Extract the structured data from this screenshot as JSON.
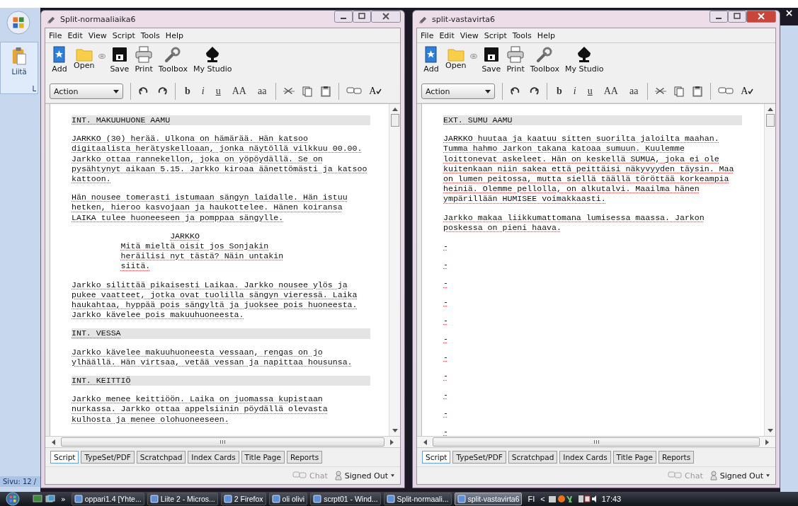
{
  "word": {
    "paste_label": "Liitä",
    "group_label": "L",
    "status": "Sivu: 12 /"
  },
  "windows": [
    {
      "title": "Split-normaaliaika6",
      "active": false,
      "menu": [
        "File",
        "Edit",
        "View",
        "Script",
        "Tools",
        "Help"
      ],
      "toolbar": [
        {
          "label": "Add",
          "kind": "add"
        },
        {
          "label": "Open",
          "kind": "open"
        },
        {
          "label": "Save",
          "kind": "save"
        },
        {
          "label": "Print",
          "kind": "print"
        },
        {
          "label": "Toolbox",
          "kind": "toolbox"
        },
        {
          "label": "My Studio",
          "kind": "studio"
        }
      ],
      "element_style": "Action",
      "format_buttons": [
        {
          "label": "b",
          "kind": "bold"
        },
        {
          "label": "i",
          "kind": "italic"
        },
        {
          "label": "u",
          "kind": "underline"
        },
        {
          "label": "AA",
          "kind": "upper"
        },
        {
          "label": "aa",
          "kind": "lower"
        }
      ],
      "spell_label": "A",
      "script": [
        {
          "kind": "heading",
          "text": "INT. MAKUUHUONE AAMU"
        },
        {
          "kind": "action",
          "text": "JARKKO (30) herää. Ulkona on hämärää. Hän katsoo digitaalista herätyskelloaan, jonka näytöllä vilkkuu 00.00. Jarkko ottaa rannekellon, joka on yöpöydällä. Se on pysähtynyt aikaan 5.15. Jarkko kiroaa äänettömästi ja katsoo kattoon."
        },
        {
          "kind": "action",
          "text": "Hän nousee tomerasti istumaan sängyn laidalle. Hän istuu hetken, hieroo kasvojaan ja haukottelee. Hänen koiransa LAIKA tulee huoneeseen ja pomppaa sängylle."
        },
        {
          "kind": "character",
          "text": "JARKKO"
        },
        {
          "kind": "dialogue",
          "text": "Mitä mieltä oisit jos Sonjakin heräilisi nyt tästä? Näin untakin siitä."
        },
        {
          "kind": "action",
          "text": "Jarkko silittää pikaisesti Laikaa.  Jarkko nousee ylös ja pukee vaatteet, jotka ovat tuolilla sängyn vieressä. Laika haukahtaa, hyppää pois sängyltä ja juoksee pois huoneesta. Jarkko kävelee pois makuuhuoneesta."
        },
        {
          "kind": "heading",
          "text": "INT. VESSA"
        },
        {
          "kind": "action",
          "text": "Jarkko kävelee makuuhuoneesta vessaan, rengas on jo ylhäällä. Hän virtsaa, vetää vessan ja napittaa housunsa."
        },
        {
          "kind": "heading",
          "text": "INT. KEITTIÖ"
        },
        {
          "kind": "action",
          "text": "Jarkko menee keittiöön. Laika on juomassa kupistaan nurkassa. Jarkko ottaa appelsiinin pöydällä olevasta kulhosta ja menee olohuoneeseen."
        }
      ],
      "tabs": [
        {
          "label": "Script",
          "selected": true
        },
        {
          "label": "TypeSet/PDF",
          "selected": false
        },
        {
          "label": "Scratchpad",
          "selected": false
        },
        {
          "label": "Index Cards",
          "selected": false
        },
        {
          "label": "Title Page",
          "selected": false
        },
        {
          "label": "Reports",
          "selected": false
        }
      ],
      "status": {
        "chat": "Chat",
        "account": "Signed Out"
      }
    },
    {
      "title": "split-vastavirta6",
      "active": true,
      "menu": [
        "File",
        "Edit",
        "View",
        "Script",
        "Tools",
        "Help"
      ],
      "toolbar": [
        {
          "label": "Add",
          "kind": "add"
        },
        {
          "label": "Open",
          "kind": "open"
        },
        {
          "label": "Save",
          "kind": "save"
        },
        {
          "label": "Print",
          "kind": "print"
        },
        {
          "label": "Toolbox",
          "kind": "toolbox"
        },
        {
          "label": "My Studio",
          "kind": "studio"
        }
      ],
      "element_style": "Action",
      "format_buttons": [
        {
          "label": "b",
          "kind": "bold"
        },
        {
          "label": "i",
          "kind": "italic"
        },
        {
          "label": "u",
          "kind": "underline"
        },
        {
          "label": "AA",
          "kind": "upper"
        },
        {
          "label": "aa",
          "kind": "lower"
        }
      ],
      "spell_label": "A",
      "script": [
        {
          "kind": "heading",
          "text": "EXT. SUMU AAMU"
        },
        {
          "kind": "action",
          "text": "JARKKO huutaa ja kaatuu sitten suorilta jaloilta maahan. Tumma hahmo Jarkon takana katoaa sumuun. Kuulemme loittonevat askeleet. Hän on keskellä SUMUA, joka ei ole kuitenkaan niin sakea että peittäisi näkyvyyden täysin. Maa on lumen peitossa, mutta siellä täällä töröttää korkeampia heiniä. Olemme pellolla, on alkutalvi. Maailma hänen ympärillään HUMISEE voimakkaasti."
        },
        {
          "kind": "action",
          "text": "Jarkko makaa liikkumattomana lumisessa maassa. Jarkon poskessa on pieni haava."
        },
        {
          "kind": "action",
          "text": "-"
        },
        {
          "kind": "action",
          "text": "-"
        },
        {
          "kind": "action",
          "text": "-"
        },
        {
          "kind": "action",
          "text": "-"
        },
        {
          "kind": "action",
          "text": "-"
        },
        {
          "kind": "action",
          "text": "-"
        },
        {
          "kind": "action",
          "text": "-"
        },
        {
          "kind": "action",
          "text": "-"
        },
        {
          "kind": "action",
          "text": "-"
        },
        {
          "kind": "action",
          "text": "-"
        },
        {
          "kind": "action",
          "text": "-"
        }
      ],
      "tabs": [
        {
          "label": "Script",
          "selected": true
        },
        {
          "label": "TypeSet/PDF",
          "selected": false
        },
        {
          "label": "Scratchpad",
          "selected": false
        },
        {
          "label": "Index Cards",
          "selected": false
        },
        {
          "label": "Title Page",
          "selected": false
        },
        {
          "label": "Reports",
          "selected": false
        }
      ],
      "status": {
        "chat": "Chat",
        "account": "Signed Out"
      }
    }
  ],
  "taskbar": {
    "overflow": "»",
    "items": [
      {
        "label": "oppari1.4 [Yhte...",
        "selected": false
      },
      {
        "label": "Liite 2 - Micros...",
        "selected": false
      },
      {
        "label": "2 Firefox",
        "selected": false
      },
      {
        "label": "oli olivi",
        "selected": false
      },
      {
        "label": "scrpt01 - Wind...",
        "selected": false
      },
      {
        "label": "Split-normaali...",
        "selected": false
      },
      {
        "label": "split-vastavirta6",
        "selected": true
      }
    ],
    "language": "FI",
    "tray_expand": "<",
    "clock": "17:43"
  }
}
